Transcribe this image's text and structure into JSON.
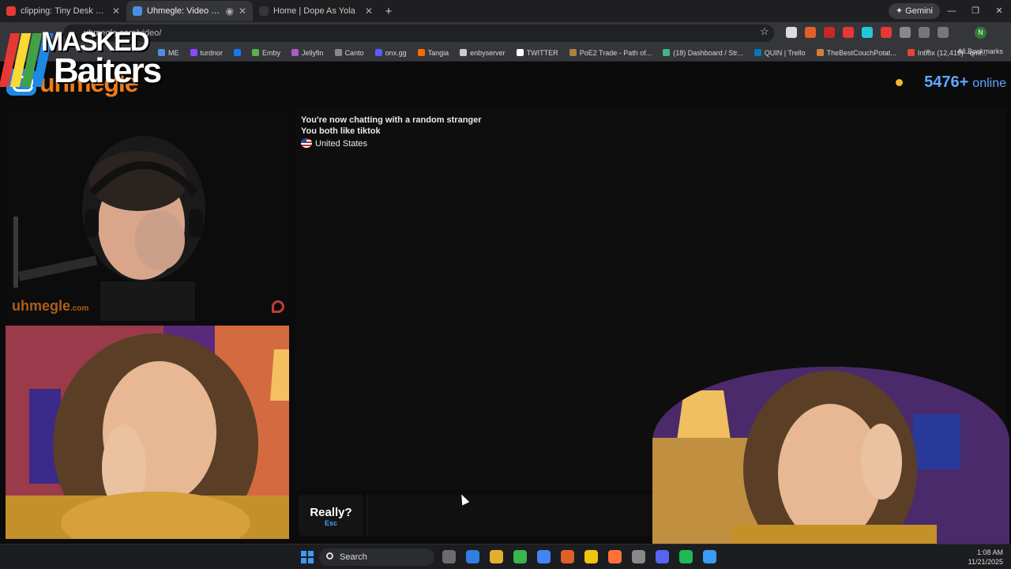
{
  "browser": {
    "tabs": [
      {
        "label": "clipping: Tiny Desk Concert - Y",
        "favicon_color": "#e53935",
        "active": false
      },
      {
        "label": "Uhmegle: Video Chat | Rand",
        "favicon_color": "#4a90e2",
        "active": true
      },
      {
        "label": "Home | Dope As Yola",
        "favicon_color": "#35363a",
        "active": false
      }
    ],
    "new_tab": "+",
    "gemini_label": "✦ Gemini",
    "url": "uhmegle.com/video/",
    "bookmarks": [
      {
        "label": "ME",
        "color": "#4a90e2"
      },
      {
        "label": "turdnor",
        "color": "#9146ff"
      },
      {
        "label": "",
        "color": "#1877f2"
      },
      {
        "label": "Emby",
        "color": "#52b54b"
      },
      {
        "label": "Jellyfin",
        "color": "#aa5cc3"
      },
      {
        "label": "Canto",
        "color": "#888888"
      },
      {
        "label": "onx.gg",
        "color": "#5a5aff"
      },
      {
        "label": "Tangia",
        "color": "#ff6a00"
      },
      {
        "label": "enbyserver",
        "color": "#cccccc"
      },
      {
        "label": "TWITTER",
        "color": "#ffffff"
      },
      {
        "label": "PoE2 Trade - Path of...",
        "color": "#b08040"
      },
      {
        "label": "(18) Dashboard / Str...",
        "color": "#43b581"
      },
      {
        "label": "QUIN | Trello",
        "color": "#0079bf"
      },
      {
        "label": "TheBestCouchPotat...",
        "color": "#d08040"
      },
      {
        "label": "Inbox (12,419) - qmi...",
        "color": "#ea4335"
      }
    ],
    "all_bookmarks": "All Bookmarks",
    "profile_initial": "N"
  },
  "site": {
    "logo_text": "uhmegle",
    "online_count": "5476+",
    "online_label": "online"
  },
  "overlay": {
    "line1": "MASKED",
    "line2": "Baiters",
    "stripe_colors": [
      "#e53935",
      "#fdd835",
      "#43a047",
      "#1e88e5"
    ]
  },
  "video": {
    "watermark": "uhmegle",
    "watermark_suffix": ".com"
  },
  "chat": {
    "line1": "You're now chatting with a random stranger",
    "line2": "You both like tiktok",
    "country": "United States"
  },
  "controls": {
    "stop_label": "Really?",
    "stop_key": "Esc"
  },
  "taskbar": {
    "search_label": "Search",
    "time": "1:08 AM",
    "date": "11/21/2025",
    "app_colors": [
      "#6c6c6c",
      "#2f7ee0",
      "#e0b030",
      "#3ab54a",
      "#4285f4",
      "#e0602a",
      "#f1c40f",
      "#ff7139",
      "#888888",
      "#5865f2",
      "#1db954",
      "#3a9bf5"
    ]
  },
  "colors": {
    "accent_blue": "#5fa8ff",
    "brand_orange": "#f07b1a",
    "online_dot": "#f5b62f"
  }
}
